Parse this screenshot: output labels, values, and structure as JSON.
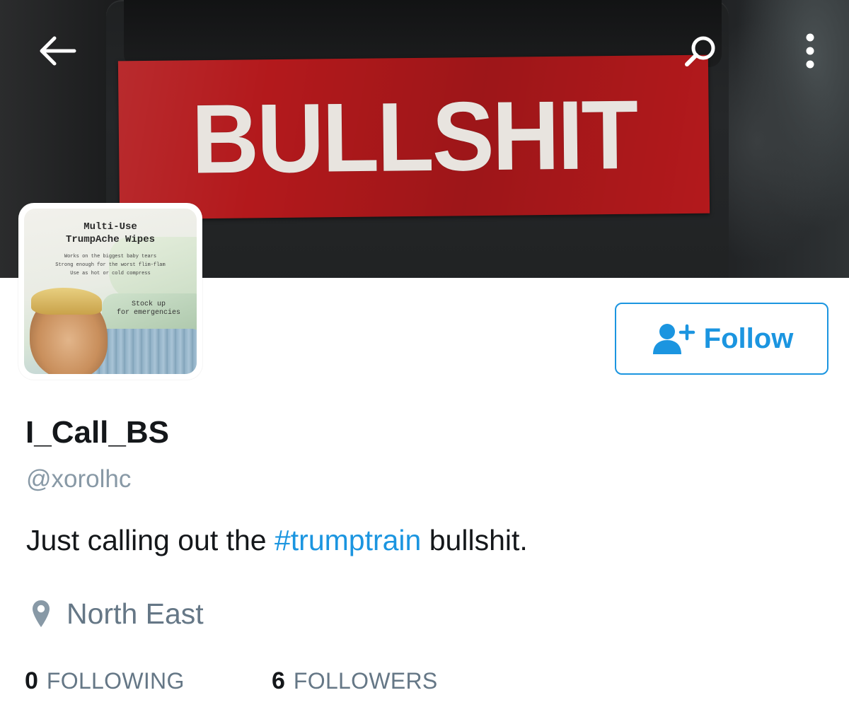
{
  "header": {
    "sticker_text": "BULLSHIT",
    "back_icon": "arrow-left-icon",
    "search_icon": "search-icon",
    "more_icon": "more-vertical-icon"
  },
  "avatar": {
    "title_line1": "Multi-Use",
    "title_line2": "TrumpAche Wipes",
    "line1": "Works on the biggest baby tears",
    "line2": "Strong enough for the worst flim-flam",
    "line3": "Use as hot or cold compress",
    "stock_line1": "Stock up",
    "stock_line2": "for emergencies"
  },
  "follow_button": {
    "label": "Follow",
    "icon": "add-user-icon"
  },
  "profile": {
    "display_name": "I_Call_BS",
    "handle": "@xorolhc",
    "bio_prefix": "Just calling out the ",
    "bio_hashtag": "#trumptrain",
    "bio_suffix": " bullshit.",
    "location_icon": "location-pin-icon",
    "location": "North East"
  },
  "stats": {
    "following_count": "0",
    "following_label": "FOLLOWING",
    "followers_count": "6",
    "followers_label": "FOLLOWERS"
  },
  "colors": {
    "accent": "#1b95e0",
    "text_primary": "#14171a",
    "text_secondary": "#657786",
    "sticker_red": "#b3191c"
  }
}
